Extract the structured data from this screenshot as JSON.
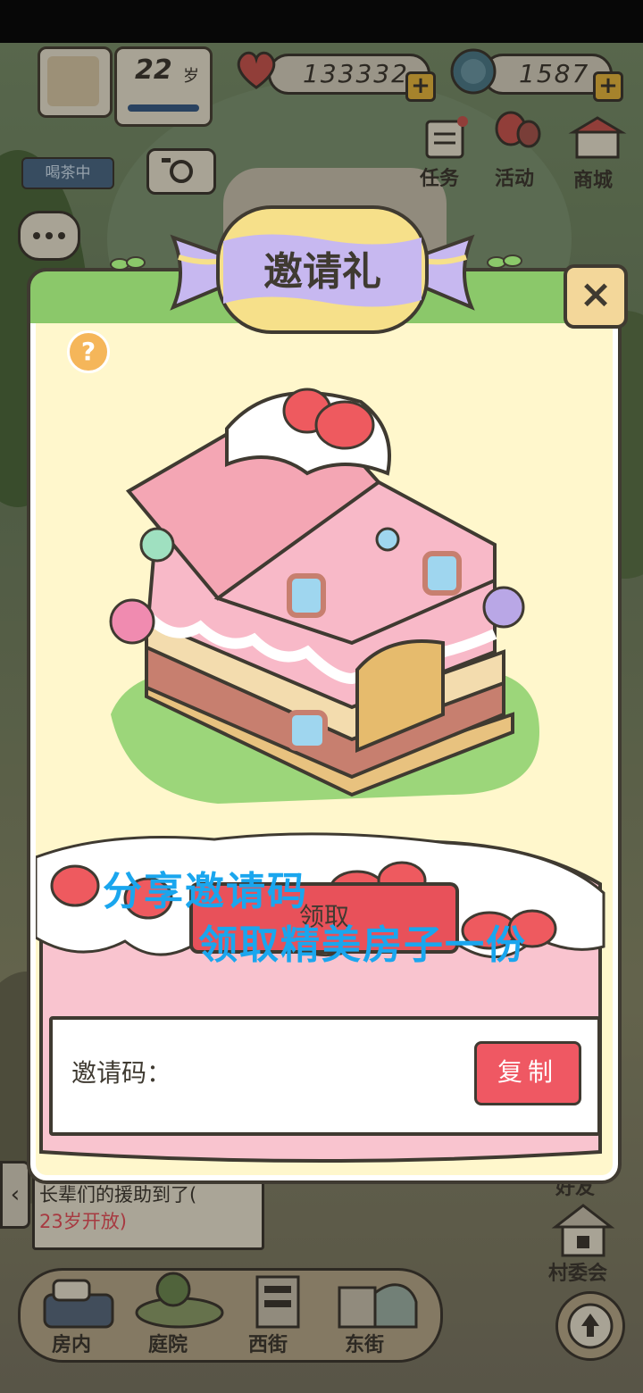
{
  "status_bar": {
    "visible": true
  },
  "hud": {
    "age_value": "22",
    "age_unit": "岁",
    "hearts": "133332",
    "coins": "1587",
    "status_tag": "喝茶中",
    "buttons": [
      {
        "label": "任务",
        "icon": "task-clipboard-icon"
      },
      {
        "label": "活动",
        "icon": "balloon-icon"
      },
      {
        "label": "商城",
        "icon": "shop-icon"
      }
    ]
  },
  "modal": {
    "title": "邀请礼",
    "close_label": "×",
    "help_label": "?",
    "share_line": "分享邀请码",
    "receive_line": "领取精美房子一份",
    "claim_button": "领取",
    "code_label": "邀请码：",
    "code_value": "",
    "copy_button": "复制"
  },
  "side": {
    "friends_label": "好友",
    "village_label": "村委会"
  },
  "message": {
    "line1": "长辈们的援助到了(",
    "line2": "23岁开放)"
  },
  "bottom_nav": {
    "tabs": [
      {
        "label": "房内"
      },
      {
        "label": "庭院"
      },
      {
        "label": "西街"
      },
      {
        "label": "东街"
      }
    ]
  },
  "colors": {
    "modal_bg": "#fff7cc",
    "accent_red": "#ef5863",
    "share_text": "#1aa6ee",
    "outline": "#3f3a31",
    "grass": "#8bc86a"
  }
}
